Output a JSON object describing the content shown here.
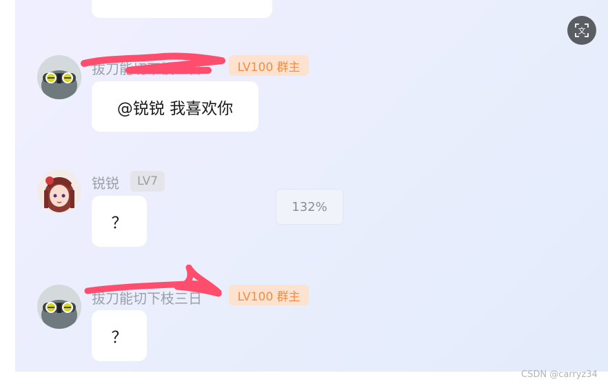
{
  "messages": [
    {
      "sender_name": "拔刀能切下枝三日",
      "badge": "LV100 群主",
      "text": "@锐锐 我喜欢你",
      "avatar": "robot-avatar"
    },
    {
      "sender_name": "锐锐",
      "badge": "LV7",
      "text": "？",
      "avatar": "anime-girl-avatar"
    },
    {
      "sender_name": "拔刀能切下枝三日",
      "badge": "LV100 群主",
      "text": "？",
      "avatar": "robot-avatar"
    }
  ],
  "zoom_level": "132%",
  "translate_icon": "文",
  "watermark": "CSDN @carryz34",
  "colors": {
    "owner_badge_bg": "#fde3cf",
    "owner_badge_text": "#f58b44",
    "scribble": "#ff4d6d"
  }
}
